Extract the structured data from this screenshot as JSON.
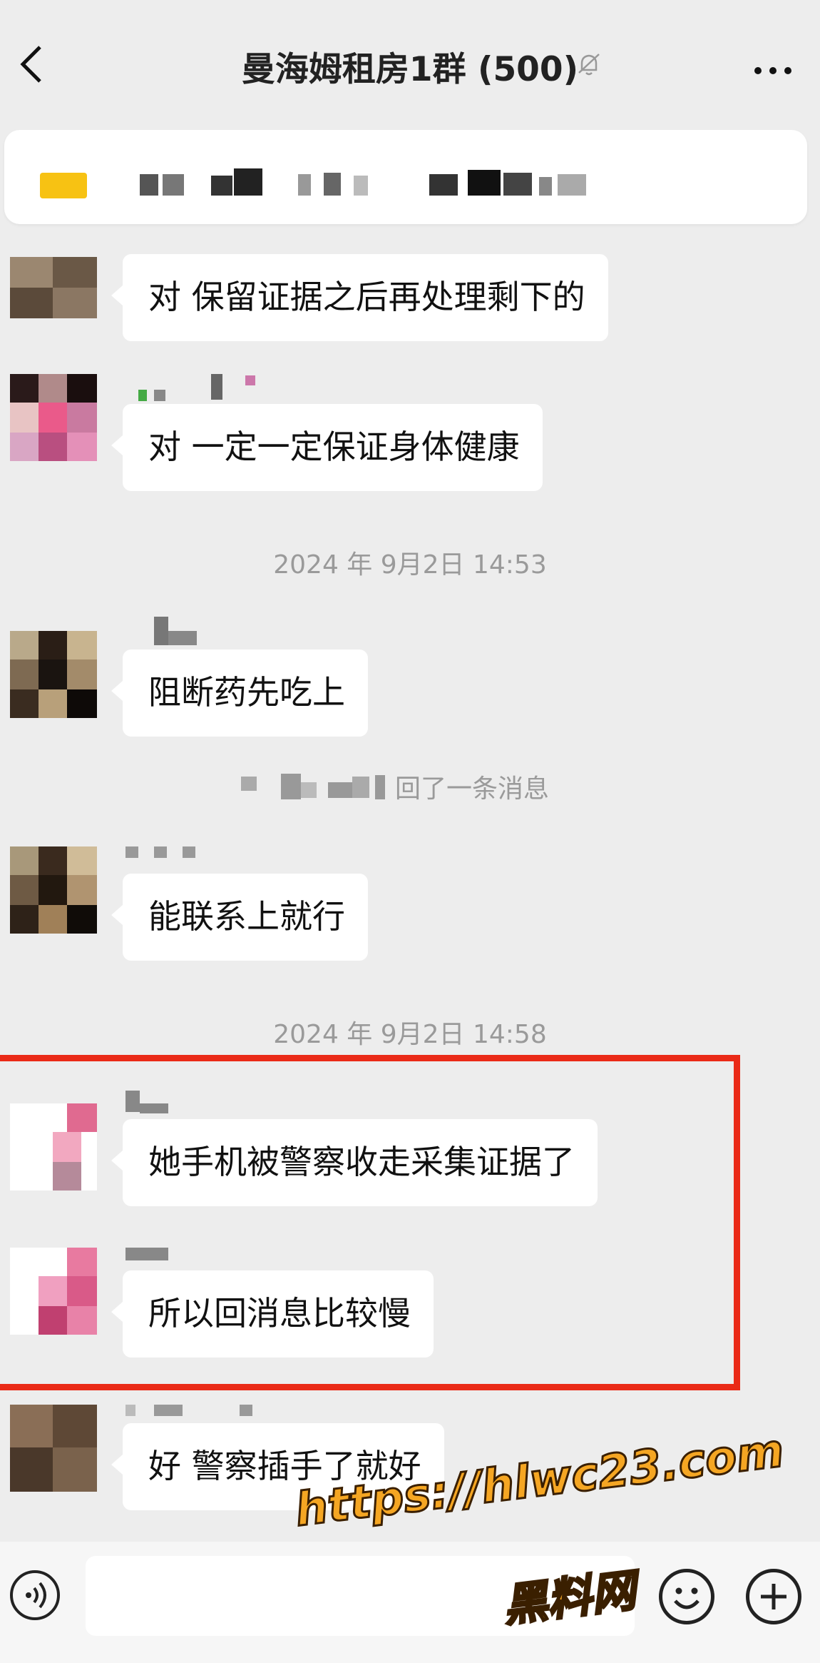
{
  "header": {
    "title": "曼海姆租房1群 (500)",
    "back_icon": "chevron-left-icon",
    "mute_icon": "bell-off-icon",
    "more_icon": "more-dots-icon"
  },
  "messages": [
    {
      "text": "对 保留证据之后再处理剩下的"
    },
    {
      "text": "对 一定一定保证身体健康"
    },
    {
      "text": "阻断药先吃上"
    },
    {
      "text": "能联系上就行"
    },
    {
      "text": "她手机被警察收走采集证据了"
    },
    {
      "text": "所以回消息比较慢"
    },
    {
      "text": "好 警察插手了就好"
    }
  ],
  "timestamps": [
    "2024 年 9月2日 14:53",
    "2024 年 9月2日 14:58"
  ],
  "system_message": "回了一条消息",
  "watermark": {
    "url": "https://hlwc23.com",
    "name": "黑料网"
  },
  "colors": {
    "background": "#ededed",
    "bubble": "#ffffff",
    "highlight_border": "#ea2a17",
    "watermark": "#f5a623"
  }
}
